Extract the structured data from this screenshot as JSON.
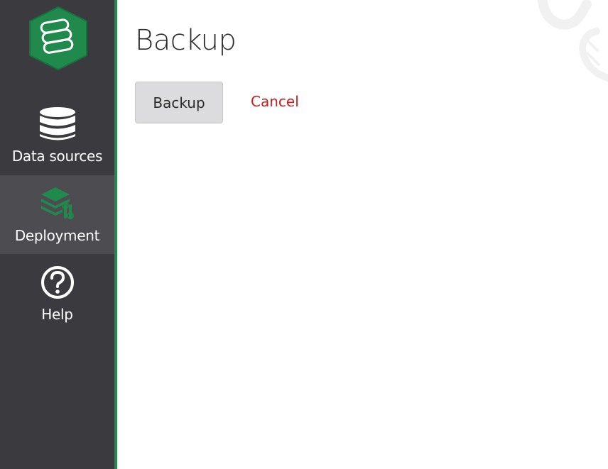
{
  "app": {
    "accent_color": "#1f8a4c",
    "sidebar_bg": "#3b3a3f",
    "sidebar_active_bg": "#4d4c51"
  },
  "sidebar": {
    "logo_icon": "database-stack-logo-icon",
    "items": [
      {
        "label": "Data sources",
        "icon": "database-icon",
        "active": false
      },
      {
        "label": "Deployment",
        "icon": "deployment-layers-icon",
        "active": true
      },
      {
        "label": "Help",
        "icon": "help-circle-icon",
        "active": false
      }
    ]
  },
  "main": {
    "title": "Backup",
    "actions": {
      "backup_label": "Backup",
      "cancel_label": "Cancel",
      "cancel_color": "#d11a1a"
    }
  }
}
